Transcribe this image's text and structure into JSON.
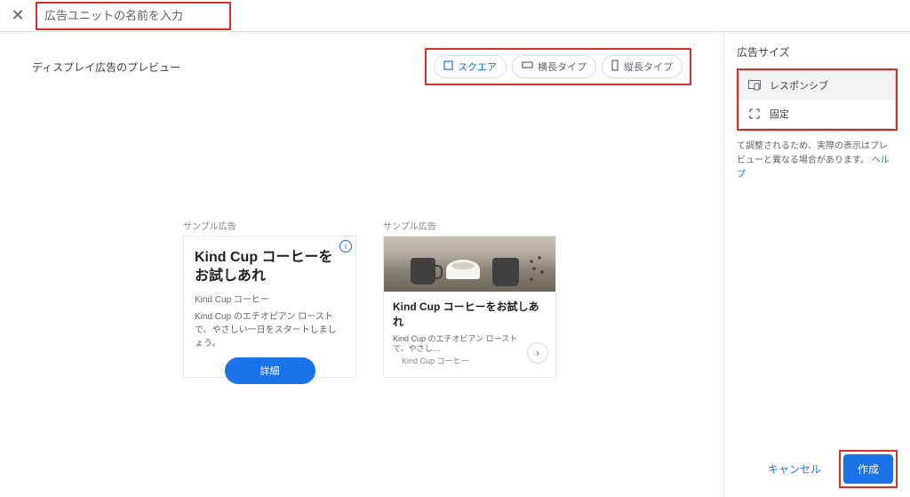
{
  "header": {
    "name_placeholder": "広告ユニットの名前を入力"
  },
  "preview": {
    "title": "ディスプレイ広告のプレビュー",
    "types": {
      "square": "スクエア",
      "horizontal": "横長タイプ",
      "vertical": "縦長タイプ"
    }
  },
  "samples": {
    "label": "サンプル広告",
    "ad1": {
      "title": "Kind Cup コーヒーをお試しあれ",
      "sub": "Kind Cup コーヒー",
      "desc": "Kind Cup のエチオピアン ローストで、やさしい一日をスタートしましょう。",
      "button": "詳細"
    },
    "ad2": {
      "title": "Kind Cup コーヒーをお試しあれ",
      "desc": "Kind Cup のエチオピアン ローストで、やさし…",
      "brand": "Kind Cup コーヒー"
    }
  },
  "sidebar": {
    "title": "広告サイズ",
    "options": {
      "responsive": "レスポンシブ",
      "fixed": "固定"
    },
    "note_prefix": "て調整されるため、実際の表示はプレビューと異なる場合があります。",
    "help": "ヘルプ"
  },
  "footer": {
    "cancel": "キャンセル",
    "create": "作成"
  }
}
